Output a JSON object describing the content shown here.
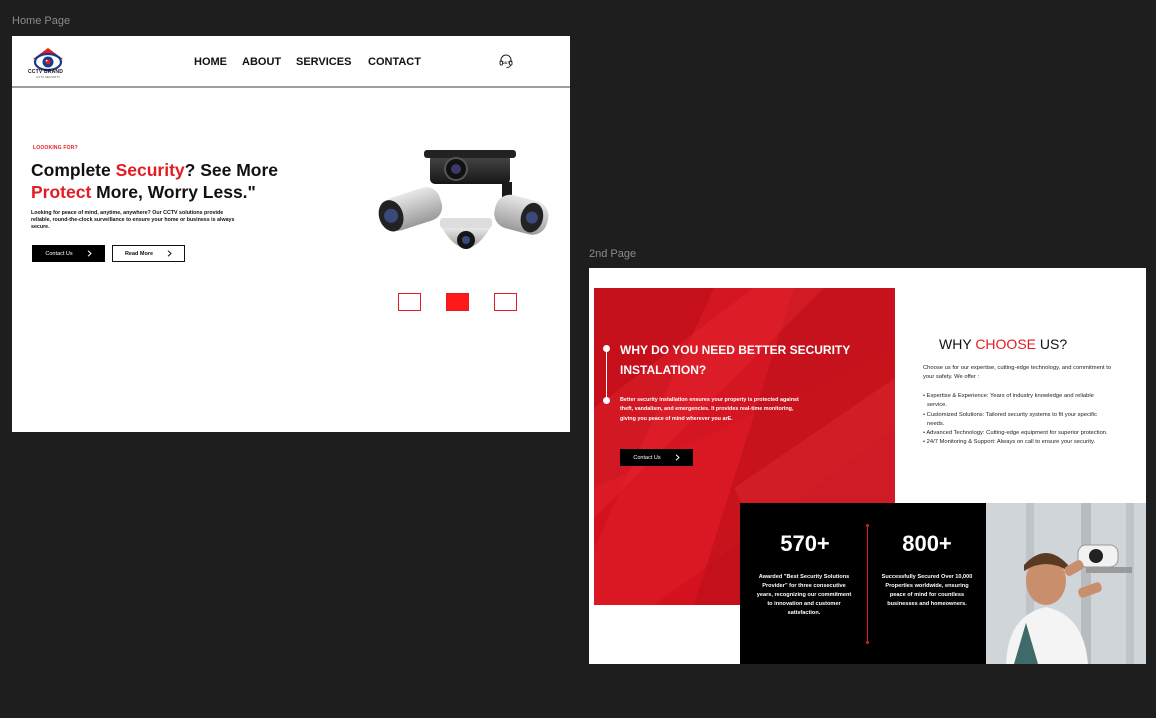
{
  "canvas": {
    "home_label": "Home Page",
    "second_label": "2nd Page"
  },
  "home": {
    "logo": {
      "brand": "CCTV BRAND",
      "tagline": "CCTV SECURITY"
    },
    "nav": {
      "home": "HOME",
      "about": "ABOUT",
      "services": "SERVICES",
      "contact": "CONTACT"
    },
    "hero": {
      "eyebrow": "LOOOKING FOR?",
      "headline_l1_a": "Complete ",
      "headline_l1_b": "Security",
      "headline_l1_c": "? See More",
      "headline_l2_a": "Protect",
      "headline_l2_b": " More, Worry Less.\"",
      "description": "Looking for peace of mind, anytime, anywhere? Our CCTV solutions provide reliable, round-the-clock surveillance to ensure your home or business is always secure.",
      "contact_btn": "Contact Us",
      "read_more_btn": "Read More"
    },
    "carousel": {
      "total": 3,
      "active_index": 1
    }
  },
  "second": {
    "why": {
      "title": "WHY DO YOU NEED BETTER SECURITY INSTALATION?",
      "description": "Better security installation ensures your property is protected against theft, vandalism, and emergencies. It provides real-time monitoring, giving you peace of mind wherever you arE.",
      "contact_btn": "Contact Us"
    },
    "choose": {
      "title_a": "WHY ",
      "title_b": "CHOOSE",
      "title_c": " US?",
      "intro": "Choose us for our expertise, cutting-edge technology, and commitment to your safety. We offer :",
      "items": [
        "• Expertise & Experience: Years of industry knowledge and reliable service.",
        "• Customized Solutions: Tailored security systems to fit your specific needs.",
        "• Advanced Technology: Cutting-edge equipment for superior protection.",
        "• 24/7 Monitoring & Support: Always on call to ensure your security."
      ]
    },
    "stats": [
      {
        "number": "570+",
        "text": "Awarded \"Best Security Solutions Provider\" for three consecutive years, recognizing our commitment to innovation and customer satisfaction."
      },
      {
        "number": "800+",
        "text": "Successfully Secured Over 10,000 Properties worldwide, ensuring peace of mind for countless businesses and homeowners."
      }
    ]
  },
  "colors": {
    "accent": "#e31b23",
    "panel_red": "#d3121e",
    "dark": "#000000"
  },
  "icons": [
    "logo-eye-icon",
    "headset-icon",
    "chevron-right-icon",
    "cctv-cameras-illustration",
    "technician-photo"
  ]
}
